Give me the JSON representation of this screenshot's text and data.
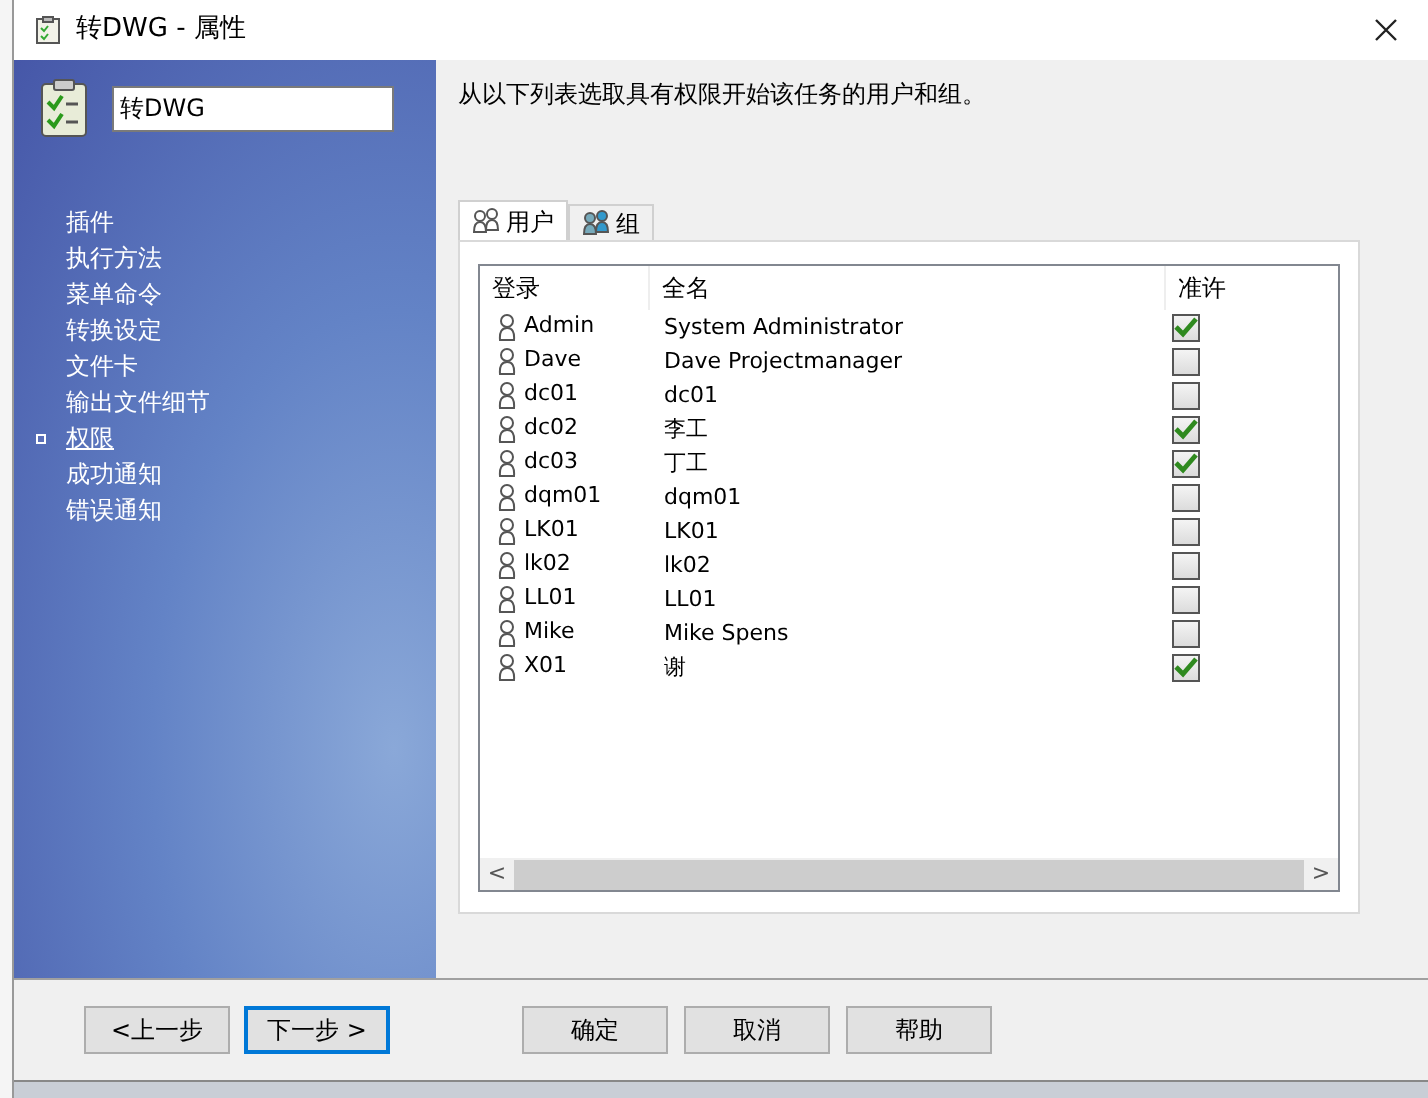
{
  "window": {
    "title": "转DWG - 属性"
  },
  "task_name": {
    "value": "转DWG"
  },
  "sidebar": {
    "items": [
      {
        "label": "插件",
        "selected": false
      },
      {
        "label": "执行方法",
        "selected": false
      },
      {
        "label": "菜单命令",
        "selected": false
      },
      {
        "label": "转换设定",
        "selected": false
      },
      {
        "label": "文件卡",
        "selected": false
      },
      {
        "label": "输出文件细节",
        "selected": false
      },
      {
        "label": "权限",
        "selected": true
      },
      {
        "label": "成功通知",
        "selected": false
      },
      {
        "label": "错误通知",
        "selected": false
      }
    ]
  },
  "instruction": "从以下列表选取具有权限开始该任务的用户和组。",
  "tabs": [
    {
      "label": "用户",
      "selected": true
    },
    {
      "label": "组",
      "selected": false
    }
  ],
  "table": {
    "columns": [
      "登录",
      "全名",
      "准许"
    ],
    "rows": [
      {
        "login": "Admin",
        "full_name": "System Administrator",
        "checked": true
      },
      {
        "login": "Dave",
        "full_name": "Dave Projectmanager",
        "checked": false
      },
      {
        "login": "dc01",
        "full_name": "dc01",
        "checked": false
      },
      {
        "login": "dc02",
        "full_name": "李工",
        "checked": true
      },
      {
        "login": "dc03",
        "full_name": "丁工",
        "checked": true
      },
      {
        "login": "dqm01",
        "full_name": "dqm01",
        "checked": false
      },
      {
        "login": "LK01",
        "full_name": "LK01",
        "checked": false
      },
      {
        "login": "lk02",
        "full_name": "lk02",
        "checked": false
      },
      {
        "login": "LL01",
        "full_name": "LL01",
        "checked": false
      },
      {
        "login": "Mike",
        "full_name": "Mike Spens",
        "checked": false
      },
      {
        "login": "X01",
        "full_name": "谢",
        "checked": true
      }
    ]
  },
  "scrollbar": {
    "left": "<",
    "right": ">"
  },
  "buttons": [
    {
      "label": "<上一步",
      "focused": false
    },
    {
      "label": "下一步 >",
      "focused": true
    },
    {
      "label": "确定",
      "focused": false
    },
    {
      "label": "取消",
      "focused": false
    },
    {
      "label": "帮助",
      "focused": false
    }
  ]
}
